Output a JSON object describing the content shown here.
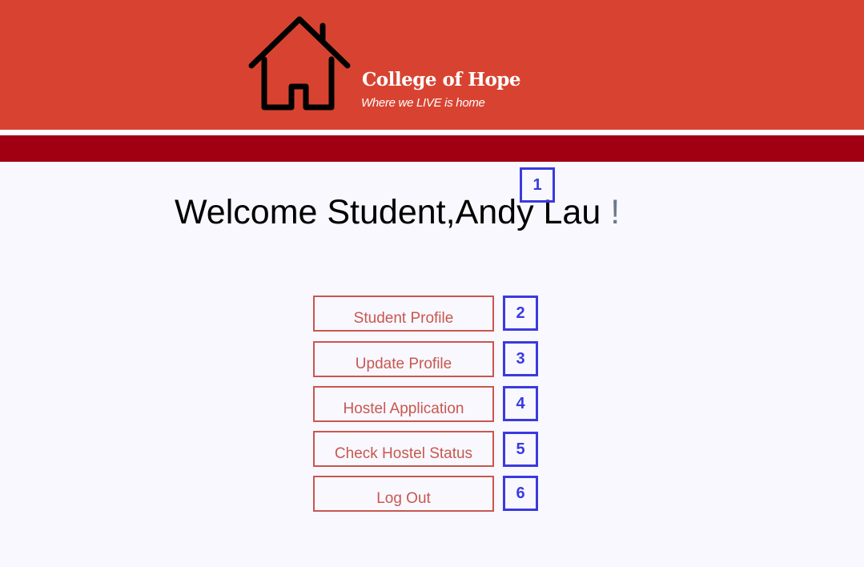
{
  "header": {
    "brand_name": "College of Hope",
    "tagline": "Where we LIVE is home",
    "logo_icon": "house-icon",
    "bg_color": "#d84331",
    "subbar_color": "#a00012"
  },
  "welcome": {
    "prefix": "Welcome Student,",
    "student_name": "Andy Lau ",
    "suffix": "!"
  },
  "menu": {
    "items": [
      {
        "label": "Student Profile"
      },
      {
        "label": "Update Profile"
      },
      {
        "label": "Hostel Application"
      },
      {
        "label": "Check Hostel Status"
      },
      {
        "label": "Log Out"
      }
    ],
    "accent_color": "#c9574f"
  },
  "markers": [
    "1",
    "2",
    "3",
    "4",
    "5",
    "6"
  ],
  "marker_color": "#3a3ae0"
}
